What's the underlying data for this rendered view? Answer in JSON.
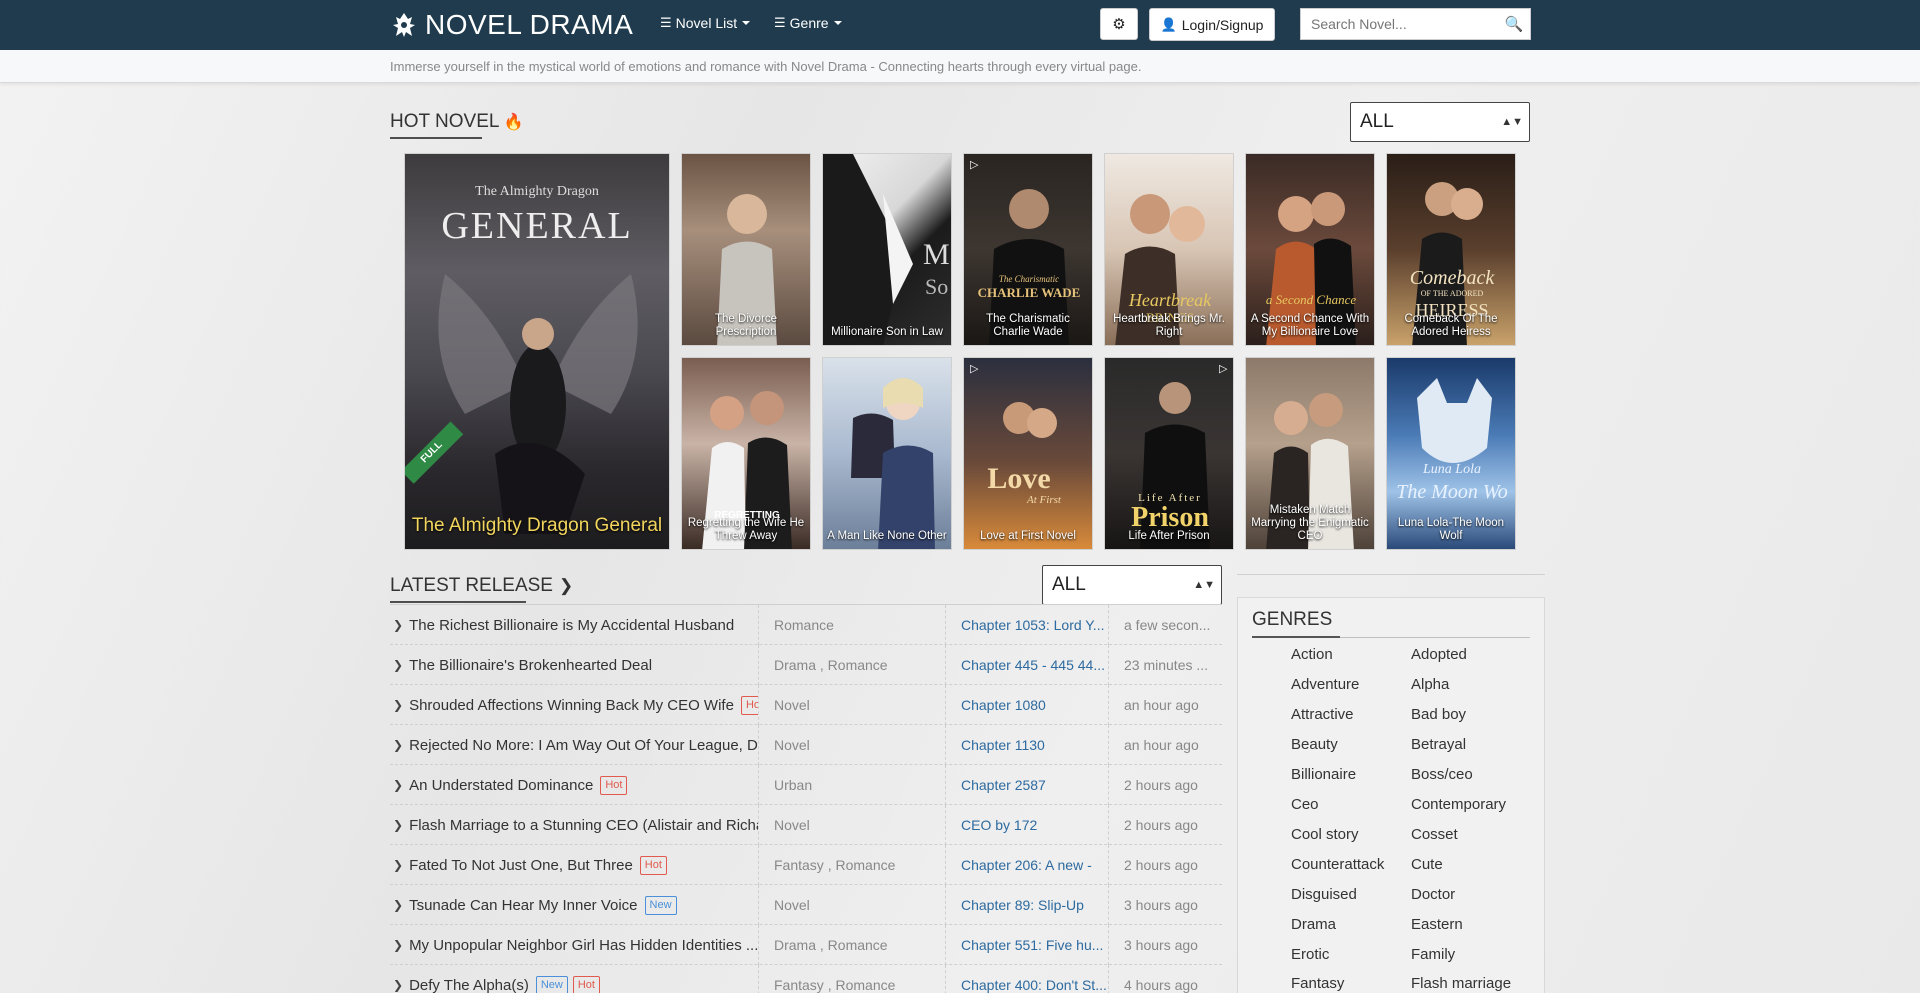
{
  "brand": {
    "name": "NOVEL DRAMA"
  },
  "nav": {
    "novel_list": "Novel List",
    "genre": "Genre",
    "login": "Login/Signup",
    "search_placeholder": "Search Novel..."
  },
  "tagline": "Immerse yourself in the mystical world of emotions and romance with Novel Drama - Connecting hearts through every virtual page.",
  "hot": {
    "title": "HOT NOVEL",
    "filter": "ALL",
    "featured": {
      "title": "The Almighty Dragon General",
      "badge": "FULL",
      "art_line1": "The Almighty Dragon",
      "art_line2": "GENERAL"
    },
    "books": [
      "The Divorce Prescription",
      "Millionaire Son in Law",
      "The Charismatic Charlie Wade",
      "Heartbreak Brings Mr. Right",
      "A Second Chance With My Billionaire Love",
      "Comeback Of The Adored Heiress",
      "Regretting the Wife He Threw Away",
      "A Man Like None Other",
      "Love at First Novel",
      "Life After Prison",
      "Mistaken Match Marrying the Enigmatic CEO",
      "Luna Lola-The Moon Wolf"
    ]
  },
  "latest": {
    "title": "LATEST RELEASE",
    "filter": "ALL",
    "rows": [
      {
        "title": "The Richest Billionaire is My Accidental Husband",
        "genre": "Romance",
        "chapter": "Chapter 1053: Lord Y...",
        "time": "a few secon..."
      },
      {
        "title": "The Billionaire's Brokenhearted Deal",
        "genre": "Drama , Romance",
        "chapter": "Chapter 445 - 445 44...",
        "time": "23 minutes ..."
      },
      {
        "title": "Shrouded Affections Winning Back My CEO Wife",
        "genre": "Novel",
        "chapter": "Chapter 1080",
        "time": "an hour ago",
        "label": "Hot"
      },
      {
        "title": "Rejected No More: I Am Way Out Of Your League, Da...",
        "genre": "Novel",
        "chapter": "Chapter 1130",
        "time": "an hour ago"
      },
      {
        "title": "An Understated Dominance",
        "genre": "Urban",
        "chapter": "Chapter 2587",
        "time": "2 hours ago",
        "label": "Hot"
      },
      {
        "title": "Flash Marriage to a Stunning CEO (Alistair and Richa...",
        "genre": "Novel",
        "chapter": "CEO by 172",
        "time": "2 hours ago"
      },
      {
        "title": "Fated To Not Just One, But Three",
        "genre": "Fantasy , Romance",
        "chapter": "Chapter 206: A new -",
        "time": "2 hours ago",
        "label": "Hot"
      },
      {
        "title": "Tsunade Can Hear My Inner Voice",
        "genre": "Novel",
        "chapter": "Chapter 89: Slip-Up",
        "time": "3 hours ago",
        "label": "New"
      },
      {
        "title": "My Unpopular Neighbor Girl Has Hidden Identities ...",
        "genre": "Drama , Romance",
        "chapter": "Chapter 551: Five hu...",
        "time": "3 hours ago",
        "label": ""
      },
      {
        "title": "Defy The Alpha(s)",
        "genre": "Fantasy , Romance",
        "chapter": "Chapter 400: Don't St...",
        "time": "4 hours ago",
        "label": "New",
        "label2": "Hot"
      }
    ]
  },
  "genres": {
    "title": "GENRES",
    "items": [
      "Action",
      "Adopted",
      "Adventure",
      "Alpha",
      "Attractive",
      "Bad boy",
      "Beauty",
      "Betrayal",
      "Billionaire",
      "Boss/ceo",
      "Ceo",
      "Contemporary",
      "Cool story",
      "Cosset",
      "Counterattack",
      "Cute",
      "Disguised",
      "Doctor",
      "Drama",
      "Eastern",
      "Erotic",
      "Family",
      "Fantasy",
      "Flash marriage"
    ]
  },
  "icons": {
    "theme": "sun-icon",
    "user": "user-icon",
    "search": "search-icon",
    "flame": "fire-icon"
  },
  "colors": {
    "navbar": "#1f3b4d",
    "hot_label": "#e05a4e",
    "new_label": "#4a90d9",
    "chapter_link": "#2d6a9f"
  }
}
